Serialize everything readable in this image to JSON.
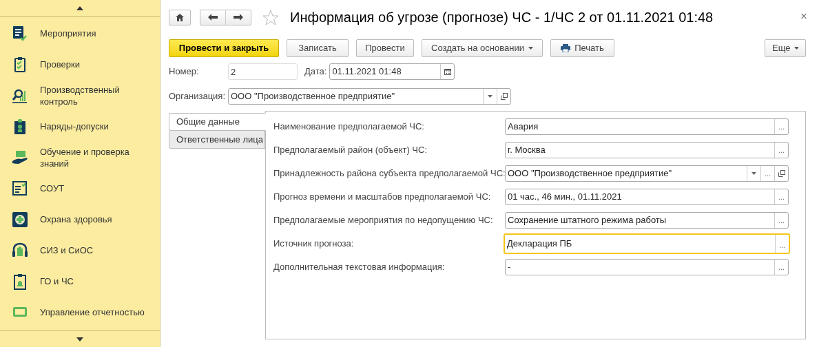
{
  "sidebar": {
    "items": [
      {
        "label": "Мероприятия"
      },
      {
        "label": "Проверки"
      },
      {
        "label": "Производственный контроль"
      },
      {
        "label": "Наряды-допуски"
      },
      {
        "label": "Обучение и проверка знаний"
      },
      {
        "label": "СОУТ"
      },
      {
        "label": "Охрана здоровья"
      },
      {
        "label": "СИЗ и СиОС"
      },
      {
        "label": "ГО и ЧС"
      },
      {
        "label": "Управление отчетностью"
      }
    ]
  },
  "window": {
    "title": "Информация об угрозе (прогнозе) ЧС - 1/ЧС 2 от 01.11.2021 01:48",
    "favorite": false,
    "close": "×"
  },
  "toolbar": {
    "buttons": [
      {
        "label": "Провести и закрыть",
        "kind": "primary"
      },
      {
        "label": "Записать",
        "kind": "plain"
      },
      {
        "label": "Провести",
        "kind": "plain"
      },
      {
        "label": "Создать на основании",
        "kind": "menu"
      },
      {
        "label": "Печать",
        "kind": "print"
      }
    ],
    "more": {
      "label": "Еще",
      "kind": "menu"
    }
  },
  "header": {
    "number_label": "Номер:",
    "number": "2",
    "date_label": "Дата:",
    "date": "01.11.2021 01:48",
    "organization_label": "Организация:",
    "organization": "ООО \"Производственное предприятие\""
  },
  "tabs": [
    {
      "label": "Общие данные",
      "selected": true
    },
    {
      "label": "Ответственные лица",
      "selected": false
    }
  ],
  "fields": [
    {
      "label": "Наименование предполагаемой ЧС:",
      "value": "Авария",
      "focused": false,
      "actions": [
        {
          "kind": "select",
          "label": "..."
        }
      ]
    },
    {
      "label": "Предполагаемый район (объект) ЧС:",
      "value": "г. Москва",
      "focused": false,
      "actions": [
        {
          "kind": "select",
          "label": "..."
        }
      ]
    },
    {
      "label": "Принадлежность района субъекта предполагаемой ЧС:",
      "value": "ООО \"Производственное предприятие\"",
      "focused": false,
      "actions": [
        {
          "kind": "dropdown"
        },
        {
          "kind": "select",
          "label": "..."
        },
        {
          "kind": "open"
        }
      ]
    },
    {
      "label": "Прогноз времени и масштабов предполагаемой ЧС:",
      "value": "01 час., 46 мин., 01.11.2021",
      "focused": false,
      "actions": [
        {
          "kind": "select",
          "label": "..."
        }
      ]
    },
    {
      "label": "Предполагаемые мероприятия по недопущению ЧС:",
      "value": "Сохранение штатного режима работы",
      "focused": false,
      "actions": [
        {
          "kind": "select",
          "label": "..."
        }
      ]
    },
    {
      "label": "Источник прогноза:",
      "value": "Декларация ПБ",
      "focused": true,
      "actions": [
        {
          "kind": "select",
          "label": "..."
        }
      ]
    },
    {
      "label": "Дополнительная текстовая информация:",
      "value": "-",
      "focused": false,
      "actions": [
        {
          "kind": "select",
          "label": "..."
        }
      ]
    }
  ]
}
